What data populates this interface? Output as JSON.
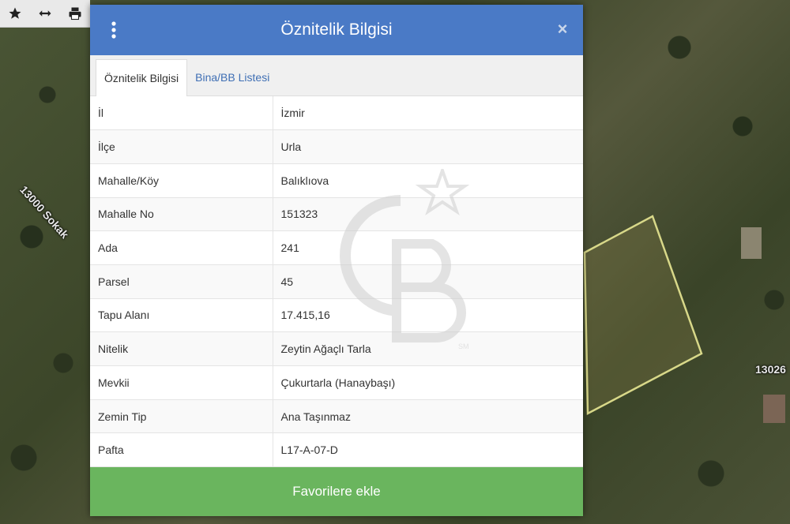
{
  "map": {
    "road_labels": [
      "13000 Sokak",
      "13026"
    ]
  },
  "toolbar": {
    "buttons": [
      {
        "icon": "star-icon"
      },
      {
        "icon": "measure-arrows-icon"
      },
      {
        "icon": "printer-icon"
      }
    ]
  },
  "modal": {
    "title": "Öznitelik Bilgisi",
    "close_label": "×",
    "tabs": [
      {
        "label": "Öznitelik Bilgisi",
        "active": true
      },
      {
        "label": "Bina/BB Listesi",
        "active": false
      }
    ],
    "rows": [
      {
        "key": "İl",
        "value": "İzmir"
      },
      {
        "key": "İlçe",
        "value": "Urla"
      },
      {
        "key": "Mahalle/Köy",
        "value": "Balıklıova"
      },
      {
        "key": "Mahalle No",
        "value": "151323"
      },
      {
        "key": "Ada",
        "value": "241"
      },
      {
        "key": "Parsel",
        "value": "45"
      },
      {
        "key": "Tapu Alanı",
        "value": "17.415,16"
      },
      {
        "key": "Nitelik",
        "value": "Zeytin Ağaçlı Tarla"
      },
      {
        "key": "Mevkii",
        "value": "Çukurtarla (Hanaybaşı)"
      },
      {
        "key": "Zemin Tip",
        "value": "Ana Taşınmaz"
      },
      {
        "key": "Pafta",
        "value": "L17-A-07-D"
      }
    ],
    "footer_button": "Favorilere ekle"
  },
  "watermark": {
    "text": "SM"
  },
  "colors": {
    "header": "#4a7ac6",
    "footer_button": "#6ab55e",
    "tab_link": "#3f6fb4",
    "parcel_outline": "#d8d889"
  }
}
